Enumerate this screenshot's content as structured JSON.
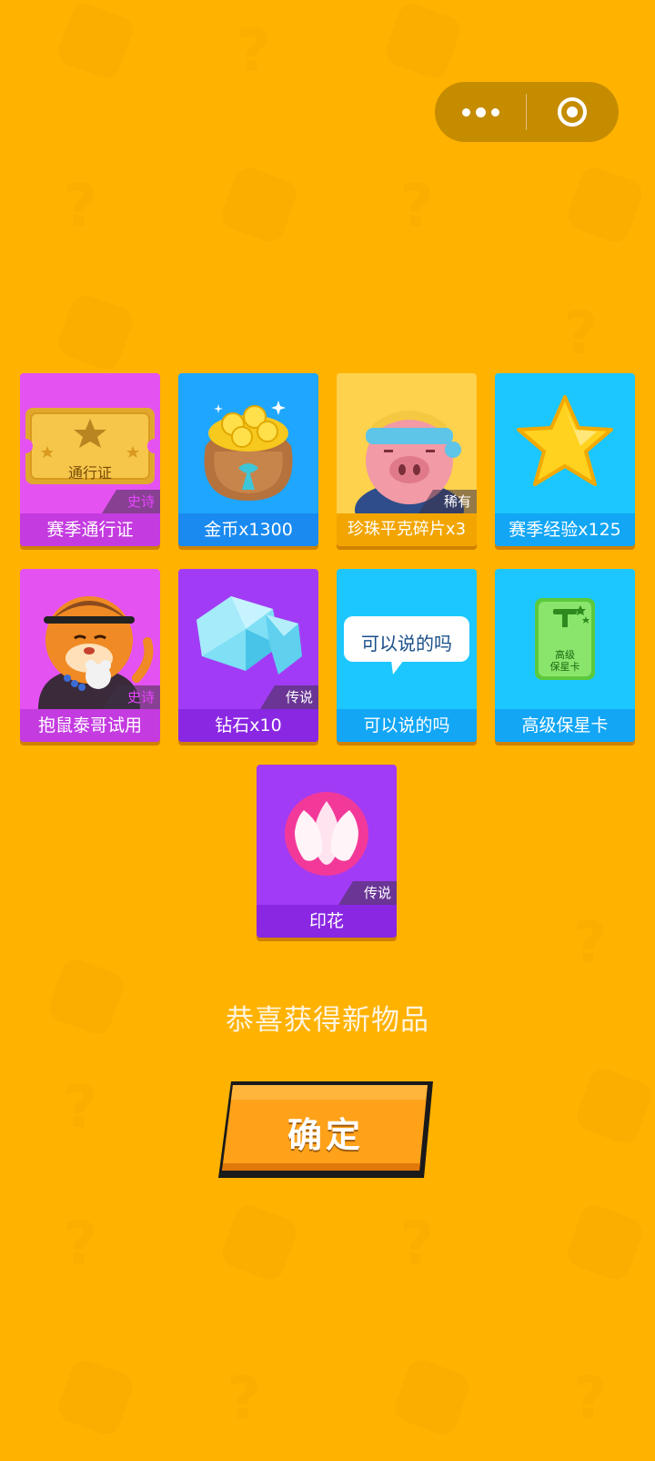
{
  "capsule": {
    "more_icon": "more-dots-icon",
    "close_icon": "target-close-icon"
  },
  "rewards": [
    {
      "name": "赛季通行证",
      "rarity": "史诗",
      "art_text": "通行证",
      "icon": "season-pass-ticket-icon",
      "bg": "#E552F2"
    },
    {
      "name": "金币x1300",
      "rarity": "",
      "icon": "coin-bag-icon",
      "bg": "#1FA6FF"
    },
    {
      "name": "珍珠平克碎片x3",
      "rarity": "稀有",
      "icon": "pig-character-icon",
      "bg": "#FFD24D"
    },
    {
      "name": "赛季经验x125",
      "rarity": "",
      "icon": "star-icon",
      "bg": "#1CC7FF"
    },
    {
      "name": "抱鼠泰哥试用",
      "rarity": "史诗",
      "icon": "tiger-character-icon",
      "bg": "#E552F2"
    },
    {
      "name": "钻石x10",
      "rarity": "传说",
      "icon": "diamond-icon",
      "bg": "#A23BF5"
    },
    {
      "name": "可以说的吗",
      "rarity": "",
      "art_text": "可以说的吗",
      "icon": "speech-bubble-icon",
      "bg": "#1CC7FF"
    },
    {
      "name": "高级保星卡",
      "rarity": "",
      "art_text_1": "高级",
      "art_text_2": "保星卡",
      "icon": "star-protect-card-icon",
      "bg": "#1CC7FF"
    },
    {
      "name": "印花",
      "rarity": "传说",
      "icon": "flower-stamp-icon",
      "bg": "#A23BF5"
    }
  ],
  "message": "恭喜获得新物品",
  "confirm_label": "确定"
}
